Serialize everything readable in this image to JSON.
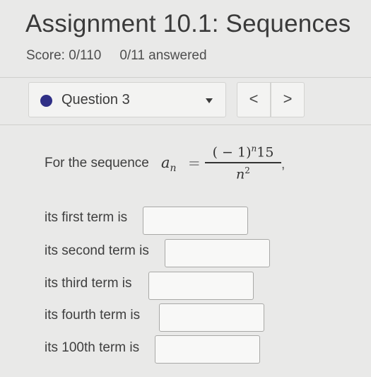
{
  "header": {
    "title": "Assignment 10.1: Sequences",
    "score": "Score: 0/110",
    "answered": "0/11 answered"
  },
  "question_nav": {
    "selected_question": "Question 3",
    "prev_label": "<",
    "next_label": ">",
    "status_dot_color": "#2f2f86"
  },
  "problem": {
    "prompt": "For the sequence",
    "sequence_var": "a",
    "sequence_sub": "n",
    "equals": "=",
    "numerator_base": "( − 1)",
    "numerator_exp": "n",
    "numerator_coef": "15",
    "denominator_base": "n",
    "denominator_exp": "2",
    "trailing": ","
  },
  "terms": [
    {
      "label": "its first term is",
      "value": ""
    },
    {
      "label": "its second term is",
      "value": ""
    },
    {
      "label": "its third term is",
      "value": ""
    },
    {
      "label": "its fourth term is",
      "value": ""
    },
    {
      "label": "its 100th term is",
      "value": ""
    }
  ]
}
